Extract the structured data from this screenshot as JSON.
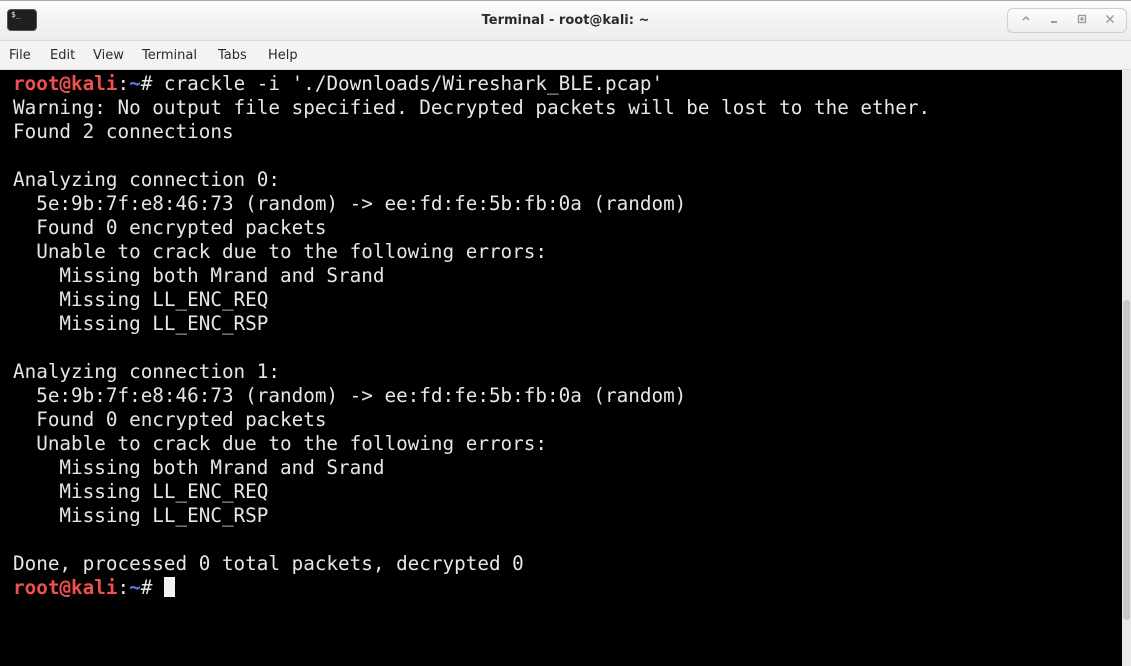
{
  "window": {
    "title": "Terminal - root@kali: ~",
    "icon_text": "$_",
    "controls": [
      "minimize-icon",
      "restore-icon",
      "close-icon"
    ]
  },
  "menubar": {
    "items": [
      "File",
      "Edit",
      "View",
      "Terminal",
      "Tabs",
      "Help"
    ]
  },
  "terminal": {
    "prompt": {
      "user": "root@kali",
      "sep": ":",
      "path": "~",
      "symbol": "# "
    },
    "command": "crackle -i './Downloads/Wireshark_BLE.pcap'",
    "output": [
      "Warning: No output file specified. Decrypted packets will be lost to the ether.",
      "Found 2 connections",
      "",
      "Analyzing connection 0:",
      "  5e:9b:7f:e8:46:73 (random) -> ee:fd:fe:5b:fb:0a (random)",
      "  Found 0 encrypted packets",
      "  Unable to crack due to the following errors:",
      "    Missing both Mrand and Srand",
      "    Missing LL_ENC_REQ",
      "    Missing LL_ENC_RSP",
      "",
      "Analyzing connection 1:",
      "  5e:9b:7f:e8:46:73 (random) -> ee:fd:fe:5b:fb:0a (random)",
      "  Found 0 encrypted packets",
      "  Unable to crack due to the following errors:",
      "    Missing both Mrand and Srand",
      "    Missing LL_ENC_REQ",
      "    Missing LL_ENC_RSP",
      "",
      "Done, processed 0 total packets, decrypted 0"
    ]
  },
  "colors": {
    "background": "#000000",
    "text": "#e6e6e6",
    "prompt_user": "#f05050",
    "prompt_path": "#5c7cfa"
  }
}
